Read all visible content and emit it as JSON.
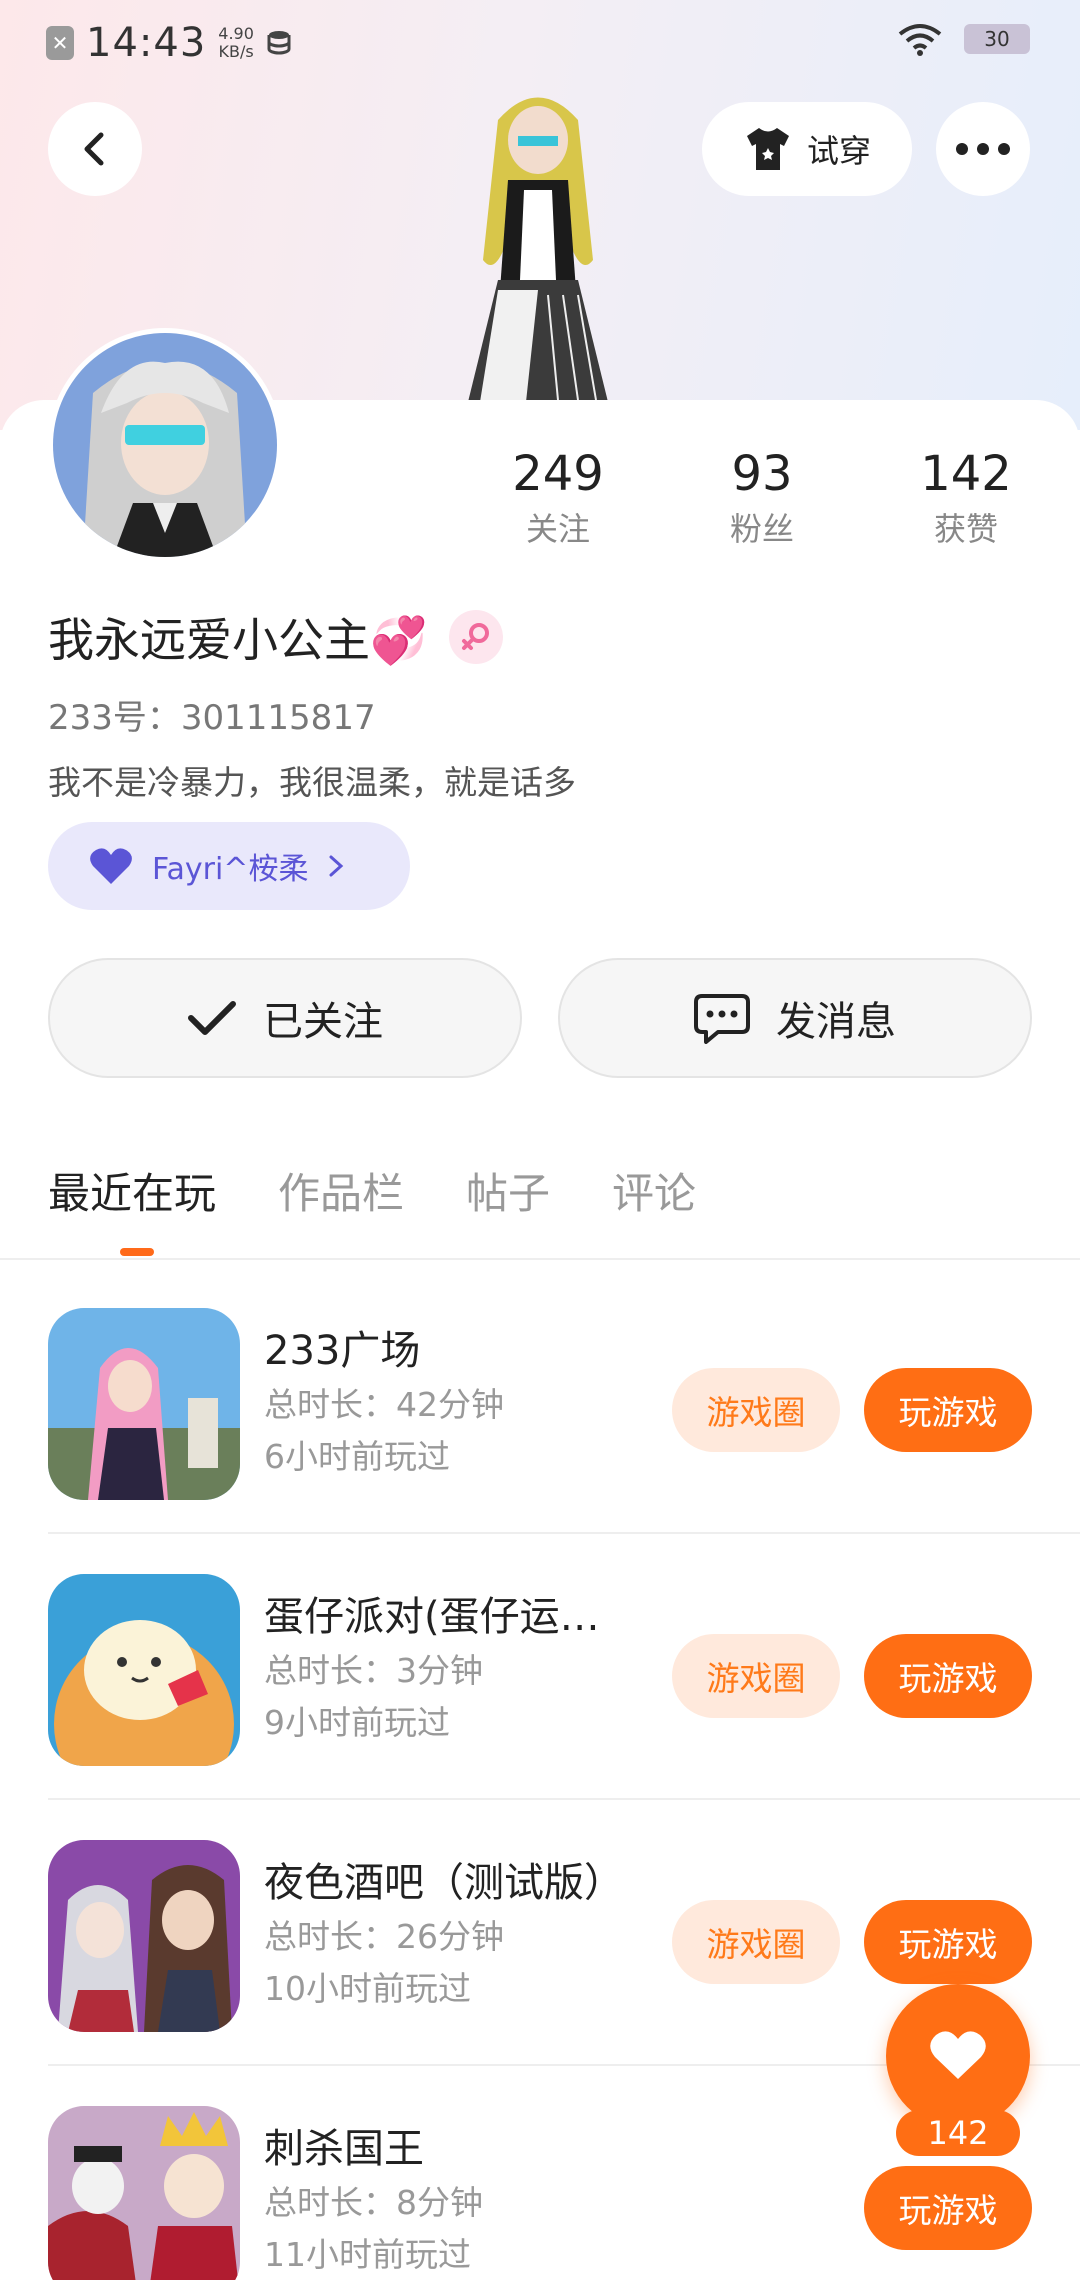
{
  "status_bar": {
    "time": "14:43",
    "speed_value": "4.90",
    "speed_unit": "KB/s",
    "battery": "30"
  },
  "header": {
    "try_on_label": "试穿"
  },
  "stats": [
    {
      "value": "249",
      "label": "关注"
    },
    {
      "value": "93",
      "label": "粉丝"
    },
    {
      "value": "142",
      "label": "获赞"
    }
  ],
  "profile": {
    "nickname": "我永远爱小公主💞",
    "uid": "233号：301115817",
    "bio": "我不是冷暴力，我很温柔，就是话多",
    "cp_tag": "Fayri^桉柔"
  },
  "actions": {
    "follow_label": "已关注",
    "message_label": "发消息"
  },
  "tabs": [
    "最近在玩",
    "作品栏",
    "帖子",
    "评论"
  ],
  "games": [
    {
      "name": "233广场",
      "duration": "总时长：42分钟",
      "last_played": "6小时前玩过",
      "circle_label": "游戏圈",
      "play_label": "玩游戏"
    },
    {
      "name": "蛋仔派对(蛋仔运…",
      "duration": "总时长：3分钟",
      "last_played": "9小时前玩过",
      "circle_label": "游戏圈",
      "play_label": "玩游戏"
    },
    {
      "name": "夜色酒吧（测试版）",
      "duration": "总时长：26分钟",
      "last_played": "10小时前玩过",
      "circle_label": "游戏圈",
      "play_label": "玩游戏"
    },
    {
      "name": "刺杀国王",
      "duration": "总时长：8分钟",
      "last_played": "11小时前玩过",
      "circle_label": "",
      "play_label": "玩游戏"
    }
  ],
  "like_fab": {
    "count": "142"
  },
  "colors": {
    "accent": "#ff6e14",
    "accent_light": "#ffe9dc",
    "cp_tag_bg": "#e9e8fb",
    "cp_tag_text": "#5b55d6"
  }
}
